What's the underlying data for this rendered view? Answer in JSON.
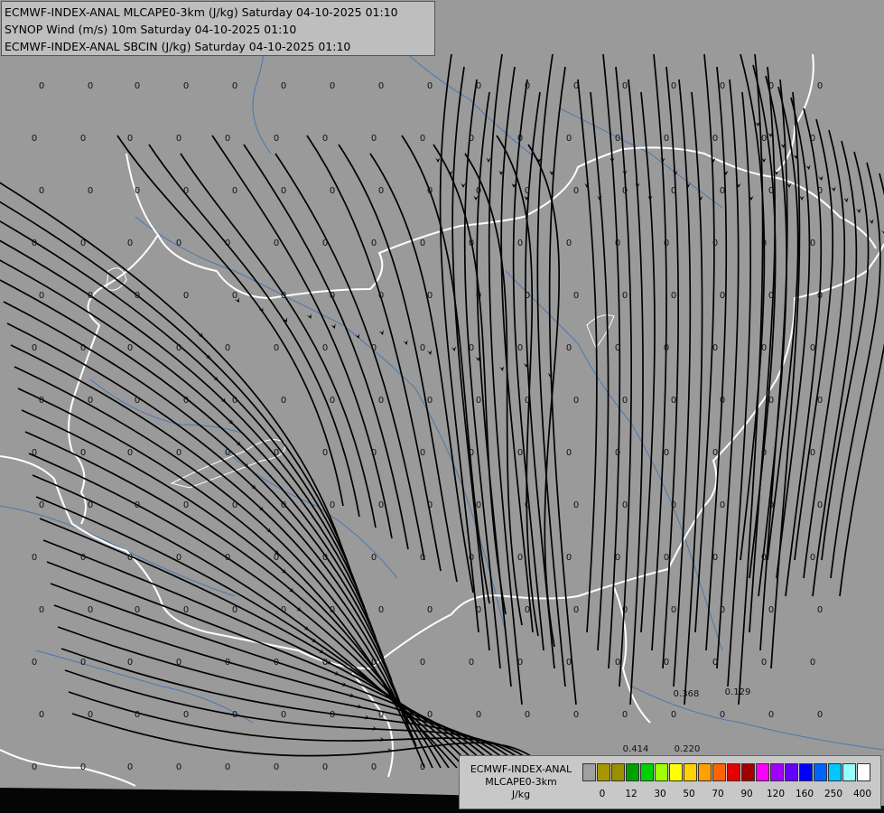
{
  "header": {
    "line1": "ECMWF-INDEX-ANAL MLCAPE0-3km (J/kg) Saturday 04-10-2025 01:10",
    "line2": "SYNOP Wind (m/s) 10m Saturday 04-10-2025 01:10",
    "line3": "ECMWF-INDEX-ANAL SBCIN (J/kg) Saturday 04-10-2025 01:10"
  },
  "legend": {
    "model": "ECMWF-INDEX-ANAL",
    "parameter": "MLCAPE0-3km",
    "unit": "J/kg",
    "colors": [
      "#a0a0a0",
      "#a89600",
      "#9c8f00",
      "#00a000",
      "#00d200",
      "#a0ff00",
      "#ffff00",
      "#ffd200",
      "#ffa000",
      "#ff6400",
      "#e60000",
      "#a00000",
      "#ff00ff",
      "#a000ff",
      "#6400ff",
      "#0000ff",
      "#0064ff",
      "#00c8ff",
      "#96ffff",
      "#ffffff"
    ],
    "ticks": [
      "0",
      "12",
      "30",
      "50",
      "70",
      "90",
      "120",
      "160",
      "250",
      "400"
    ]
  },
  "station_values": [
    "0",
    "0.368",
    "0.129",
    "0.414",
    "0.220"
  ],
  "colors": {
    "background": "#9a9a9a",
    "streamline": "#000000",
    "border": "#ffffff",
    "river": "#4a78b0"
  }
}
